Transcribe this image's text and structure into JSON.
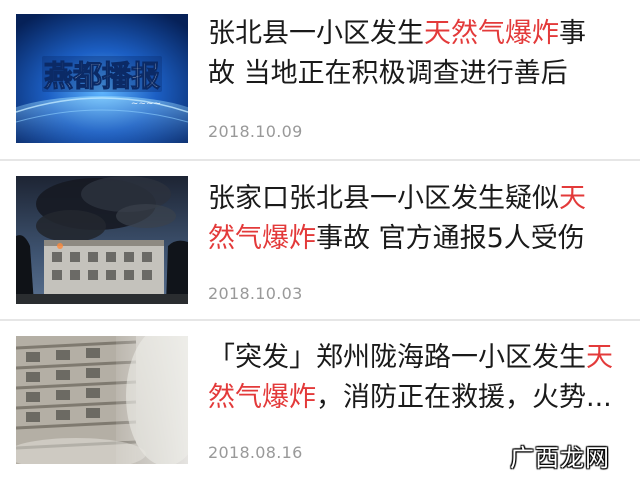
{
  "news": [
    {
      "thumb_icon": "news-broadcast-logo-image",
      "thumb_logo_text": "燕都播报",
      "title_line1": [
        "张北县一小区发生",
        "天然气爆炸",
        "事"
      ],
      "title_line2": "故 当地正在积极调查进行善后",
      "date": "2018.10.09"
    },
    {
      "thumb_icon": "smoke-building-photo",
      "title_line1": [
        "张家口张北县一小区发生疑似",
        "天"
      ],
      "title_line2": [
        "然气爆炸",
        "事故 官方通报5人受伤"
      ],
      "date": "2018.10.03"
    },
    {
      "thumb_icon": "highrise-fire-photo",
      "title_line1": [
        "「突发」郑州陇海路一小区发生",
        "天"
      ],
      "title_line2": [
        "然气爆炸",
        "，消防正在救援，火势..."
      ],
      "date": "2018.08.16"
    }
  ],
  "highlight_color": "#e33a3a",
  "watermark": "广西龙网"
}
